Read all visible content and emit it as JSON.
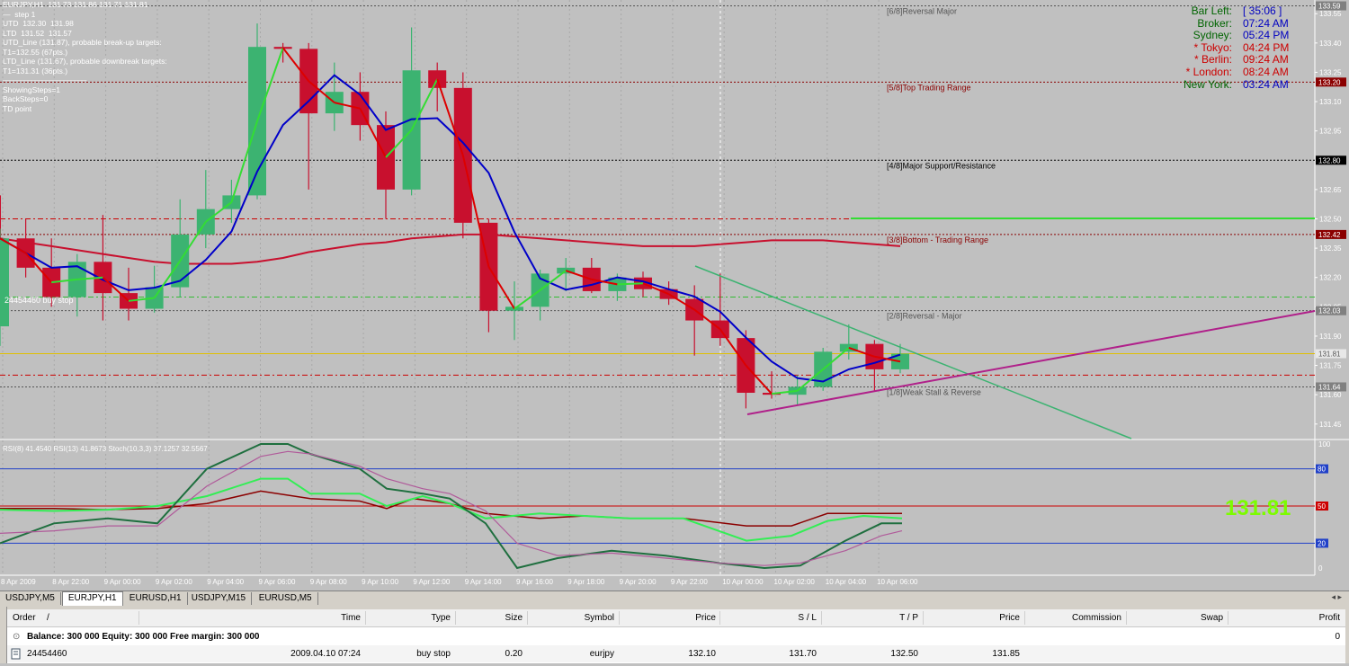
{
  "info_panel": {
    "lines": [
      "EURJPY,H1  131.73 131.86 131.71 131.81",
      "—  step 1",
      "UTD  132.30  131.98",
      "LTD  131.52  131.57",
      "UTD_Line (131.87), probable break-up targets:",
      "T1=132.55 (67pts.)",
      "LTD_Line (131.67), probable downbreak targets:",
      "T1=131.31 (36pts.)",
      "———————————",
      "ShowingSteps=1",
      "BackSteps=0",
      "TD point"
    ]
  },
  "clock": {
    "rows": [
      {
        "label": "Bar Left:",
        "value": "[ 35:06 ]",
        "label_color": "#006400",
        "value_color": "#0000c0"
      },
      {
        "label": "Broker:",
        "value": "07:24 AM",
        "label_color": "#006400",
        "value_color": "#0000c0"
      },
      {
        "label": "Sydney:",
        "value": "05:24 PM",
        "label_color": "#006400",
        "value_color": "#0000c0"
      },
      {
        "label": "* Tokyo:",
        "value": "04:24 PM",
        "label_color": "#cc0000",
        "value_color": "#cc0000"
      },
      {
        "label": "* Berlin:",
        "value": "09:24 AM",
        "label_color": "#cc0000",
        "value_color": "#cc0000"
      },
      {
        "label": "* London:",
        "value": "08:24 AM",
        "label_color": "#cc0000",
        "value_color": "#cc0000"
      },
      {
        "label": "New York:",
        "value": "03:24 AM",
        "label_color": "#006400",
        "value_color": "#0000c0"
      }
    ]
  },
  "murrey_labels": {
    "l68": "[6/8]Reversal Major",
    "l58": "[5/8]Top Trading Range",
    "l48": "[4/8]Major Support/Resistance",
    "l38": "[3/8]Bottom - Trading Range",
    "l28": "[2/8]Reversal - Major",
    "l18": "[1/8]Weak Stall & Reverse"
  },
  "order_label": "24454460 buy stop",
  "price_axis": {
    "ticks": [
      "133.55",
      "133.40",
      "133.25",
      "133.10",
      "132.95",
      "132.80",
      "132.65",
      "132.50",
      "132.35",
      "132.20",
      "132.05",
      "131.90",
      "131.75",
      "131.60",
      "131.45"
    ],
    "tags": [
      {
        "text": "133.59",
        "kind": "grey"
      },
      {
        "text": "133.20",
        "kind": "red"
      },
      {
        "text": "132.80",
        "kind": "black"
      },
      {
        "text": "132.42",
        "kind": "red"
      },
      {
        "text": "132.03",
        "kind": "grey"
      },
      {
        "text": "131.81",
        "kind": "white"
      },
      {
        "text": "131.64",
        "kind": "grey"
      }
    ]
  },
  "indicator": {
    "label": "RSI(8) 41.4540  RSI(13) 41.8673  Stoch(10,3,3) 37.1257 32.5567",
    "ticks": [
      "100",
      "80",
      "50",
      "20",
      "0"
    ],
    "big_price": "131.81"
  },
  "time_axis": [
    "8 Apr 2009",
    "8 Apr 22:00",
    "9 Apr 00:00",
    "9 Apr 02:00",
    "9 Apr 04:00",
    "9 Apr 06:00",
    "9 Apr 08:00",
    "9 Apr 10:00",
    "9 Apr 12:00",
    "9 Apr 14:00",
    "9 Apr 16:00",
    "9 Apr 18:00",
    "9 Apr 20:00",
    "9 Apr 22:00",
    "10 Apr 00:00",
    "10 Apr 02:00",
    "10 Apr 04:00",
    "10 Apr 06:00"
  ],
  "tabs": [
    "USDJPY,M5",
    "EURJPY,H1",
    "EURUSD,H1",
    "USDJPY,M15",
    "EURUSD,M5"
  ],
  "active_tab": 1,
  "tab_nav": "◂ ▸",
  "terminal": {
    "columns": [
      "Order",
      "/",
      "Time",
      "Type",
      "Size",
      "Symbol",
      "Price",
      "S / L",
      "T / P",
      "Price",
      "Commission",
      "Swap",
      "Profit"
    ],
    "balance_line": "Balance: 300 000  Equity: 300 000  Free margin: 300 000",
    "balance_profit": "0",
    "order_row": {
      "order": "24454460",
      "time": "2009.04.10 07:24",
      "type": "buy stop",
      "size": "0.20",
      "symbol": "eurjpy",
      "price": "132.10",
      "sl": "131.70",
      "tp": "132.50",
      "market_price": "131.85",
      "commission": "",
      "swap": "",
      "profit": ""
    }
  },
  "chart_data": {
    "type": "candlestick",
    "symbol": "EURJPY",
    "timeframe": "H1",
    "ylim": [
      131.38,
      133.62
    ],
    "candles": [
      {
        "o": 131.95,
        "h": 132.45,
        "l": 131.85,
        "c": 132.4
      },
      {
        "o": 132.4,
        "h": 132.5,
        "l": 132.2,
        "c": 132.25
      },
      {
        "o": 132.25,
        "h": 132.4,
        "l": 132.05,
        "c": 132.1
      },
      {
        "o": 132.1,
        "h": 132.32,
        "l": 132.0,
        "c": 132.28
      },
      {
        "o": 132.28,
        "h": 132.52,
        "l": 131.98,
        "c": 132.12
      },
      {
        "o": 132.12,
        "h": 132.25,
        "l": 131.98,
        "c": 132.04
      },
      {
        "o": 132.04,
        "h": 132.26,
        "l": 132.02,
        "c": 132.15
      },
      {
        "o": 132.15,
        "h": 132.6,
        "l": 132.1,
        "c": 132.42
      },
      {
        "o": 132.42,
        "h": 132.75,
        "l": 132.35,
        "c": 132.55
      },
      {
        "o": 132.55,
        "h": 132.7,
        "l": 132.48,
        "c": 132.62
      },
      {
        "o": 132.62,
        "h": 133.5,
        "l": 132.6,
        "c": 133.38
      },
      {
        "o": 133.38,
        "h": 133.4,
        "l": 133.3,
        "c": 133.37
      },
      {
        "o": 133.37,
        "h": 133.4,
        "l": 132.65,
        "c": 133.04
      },
      {
        "o": 133.04,
        "h": 133.3,
        "l": 132.95,
        "c": 133.15
      },
      {
        "o": 133.15,
        "h": 133.25,
        "l": 132.9,
        "c": 132.98
      },
      {
        "o": 132.98,
        "h": 133.05,
        "l": 132.5,
        "c": 132.65
      },
      {
        "o": 132.65,
        "h": 133.48,
        "l": 132.62,
        "c": 133.26
      },
      {
        "o": 133.26,
        "h": 133.3,
        "l": 133.05,
        "c": 133.17
      },
      {
        "o": 133.17,
        "h": 133.25,
        "l": 132.4,
        "c": 132.48
      },
      {
        "o": 132.48,
        "h": 132.5,
        "l": 131.92,
        "c": 132.03
      },
      {
        "o": 132.03,
        "h": 132.18,
        "l": 131.88,
        "c": 132.05
      },
      {
        "o": 132.05,
        "h": 132.24,
        "l": 131.98,
        "c": 132.22
      },
      {
        "o": 132.22,
        "h": 132.3,
        "l": 132.13,
        "c": 132.25
      },
      {
        "o": 132.25,
        "h": 132.3,
        "l": 132.12,
        "c": 132.13
      },
      {
        "o": 132.13,
        "h": 132.22,
        "l": 132.08,
        "c": 132.2
      },
      {
        "o": 132.2,
        "h": 132.23,
        "l": 132.1,
        "c": 132.14
      },
      {
        "o": 132.14,
        "h": 132.18,
        "l": 132.06,
        "c": 132.09
      },
      {
        "o": 132.09,
        "h": 132.16,
        "l": 131.8,
        "c": 131.98
      },
      {
        "o": 131.98,
        "h": 132.22,
        "l": 131.85,
        "c": 131.89
      },
      {
        "o": 131.89,
        "h": 131.93,
        "l": 131.53,
        "c": 131.61
      },
      {
        "o": 131.61,
        "h": 131.72,
        "l": 131.58,
        "c": 131.6
      },
      {
        "o": 131.6,
        "h": 131.7,
        "l": 131.55,
        "c": 131.64
      },
      {
        "o": 131.64,
        "h": 131.84,
        "l": 131.62,
        "c": 131.82
      },
      {
        "o": 131.82,
        "h": 131.96,
        "l": 131.78,
        "c": 131.86
      },
      {
        "o": 131.86,
        "h": 131.88,
        "l": 131.62,
        "c": 131.73
      },
      {
        "o": 131.73,
        "h": 131.86,
        "l": 131.71,
        "c": 131.81
      }
    ],
    "murrey_levels": {
      "l68": 133.59,
      "l58": 133.2,
      "l48": 132.8,
      "l38": 132.42,
      "l28": 132.03,
      "l18": 131.64
    },
    "horizontal_levels": {
      "current_price": 131.81,
      "buy_stop": 132.1,
      "take_profit": 132.5,
      "stop_loss": 131.7
    },
    "indicator_levels": [
      80,
      50,
      20
    ],
    "series_colors": {
      "bull": "#3cb371",
      "bear": "#c8102e",
      "ma_long": "#c8102e",
      "ma_fast": "#0000c8",
      "zigzag_up": "#33dd33",
      "zigzag_down": "#dd0000"
    }
  }
}
